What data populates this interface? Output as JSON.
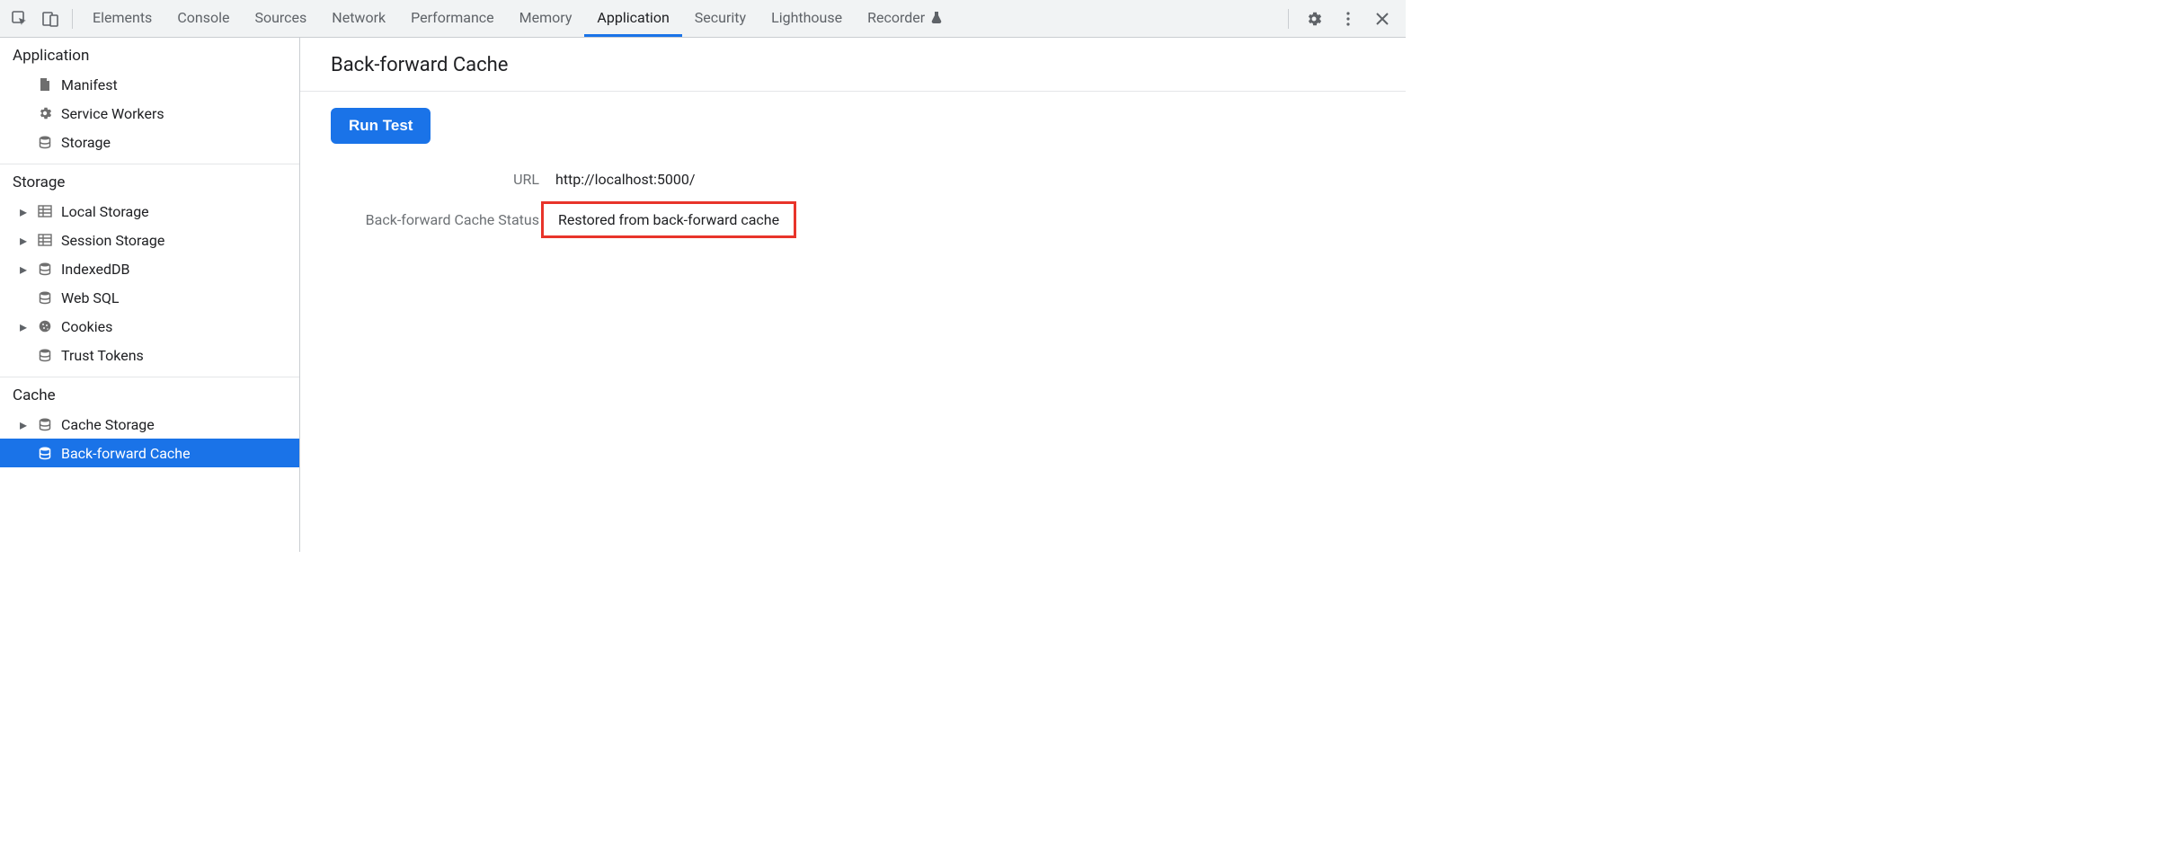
{
  "tabs": [
    {
      "label": "Elements"
    },
    {
      "label": "Console"
    },
    {
      "label": "Sources"
    },
    {
      "label": "Network"
    },
    {
      "label": "Performance"
    },
    {
      "label": "Memory"
    },
    {
      "label": "Application",
      "active": true
    },
    {
      "label": "Security"
    },
    {
      "label": "Lighthouse"
    },
    {
      "label": "Recorder",
      "hasFlask": true
    }
  ],
  "sidebar": {
    "groups": [
      {
        "title": "Application",
        "items": [
          {
            "label": "Manifest",
            "icon": "file",
            "expandable": false
          },
          {
            "label": "Service Workers",
            "icon": "gear",
            "expandable": false
          },
          {
            "label": "Storage",
            "icon": "database",
            "expandable": false
          }
        ]
      },
      {
        "title": "Storage",
        "items": [
          {
            "label": "Local Storage",
            "icon": "grid",
            "expandable": true
          },
          {
            "label": "Session Storage",
            "icon": "grid",
            "expandable": true
          },
          {
            "label": "IndexedDB",
            "icon": "database",
            "expandable": true
          },
          {
            "label": "Web SQL",
            "icon": "database",
            "expandable": false
          },
          {
            "label": "Cookies",
            "icon": "cookie",
            "expandable": true
          },
          {
            "label": "Trust Tokens",
            "icon": "database",
            "expandable": false
          }
        ]
      },
      {
        "title": "Cache",
        "items": [
          {
            "label": "Cache Storage",
            "icon": "database",
            "expandable": true
          },
          {
            "label": "Back-forward Cache",
            "icon": "database",
            "expandable": false,
            "selected": true
          }
        ]
      }
    ]
  },
  "main": {
    "title": "Back-forward Cache",
    "runButton": "Run Test",
    "urlLabel": "URL",
    "urlValue": "http://localhost:5000/",
    "statusLabel": "Back-forward Cache Status",
    "statusValue": "Restored from back-forward cache"
  }
}
